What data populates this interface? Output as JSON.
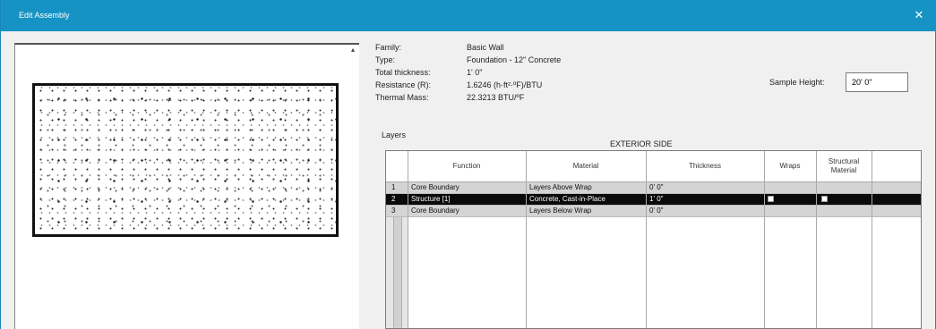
{
  "window": {
    "title": "Edit Assembly",
    "close_glyph": "✕"
  },
  "preview": {
    "collapse_glyph": "▴"
  },
  "properties": [
    {
      "label": "Family:",
      "value": "Basic Wall"
    },
    {
      "label": "Type:",
      "value": "Foundation - 12\" Concrete"
    },
    {
      "label": "Total thickness:",
      "value": "1' 0\""
    },
    {
      "label": "Resistance (R):",
      "value": "1.6246 (h·ft²·ºF)/BTU"
    },
    {
      "label": "Thermal Mass:",
      "value": "22.3213 BTU/ºF"
    }
  ],
  "sample_height": {
    "label": "Sample Height:",
    "value": "20' 0\""
  },
  "layers": {
    "label": "Layers",
    "side_label": "EXTERIOR SIDE",
    "columns": [
      "Function",
      "Material",
      "Thickness",
      "Wraps",
      "Structural Material"
    ],
    "rows": [
      {
        "num": "1",
        "function": "Core Boundary",
        "material": "Layers Above Wrap",
        "thickness": "0' 0\"",
        "selected": false
      },
      {
        "num": "2",
        "function": "Structure [1]",
        "material": "Concrete, Cast-in-Place",
        "thickness": "1' 0\"",
        "selected": true
      },
      {
        "num": "3",
        "function": "Core Boundary",
        "material": "Layers Below Wrap",
        "thickness": "0' 0\"",
        "selected": false
      }
    ]
  }
}
